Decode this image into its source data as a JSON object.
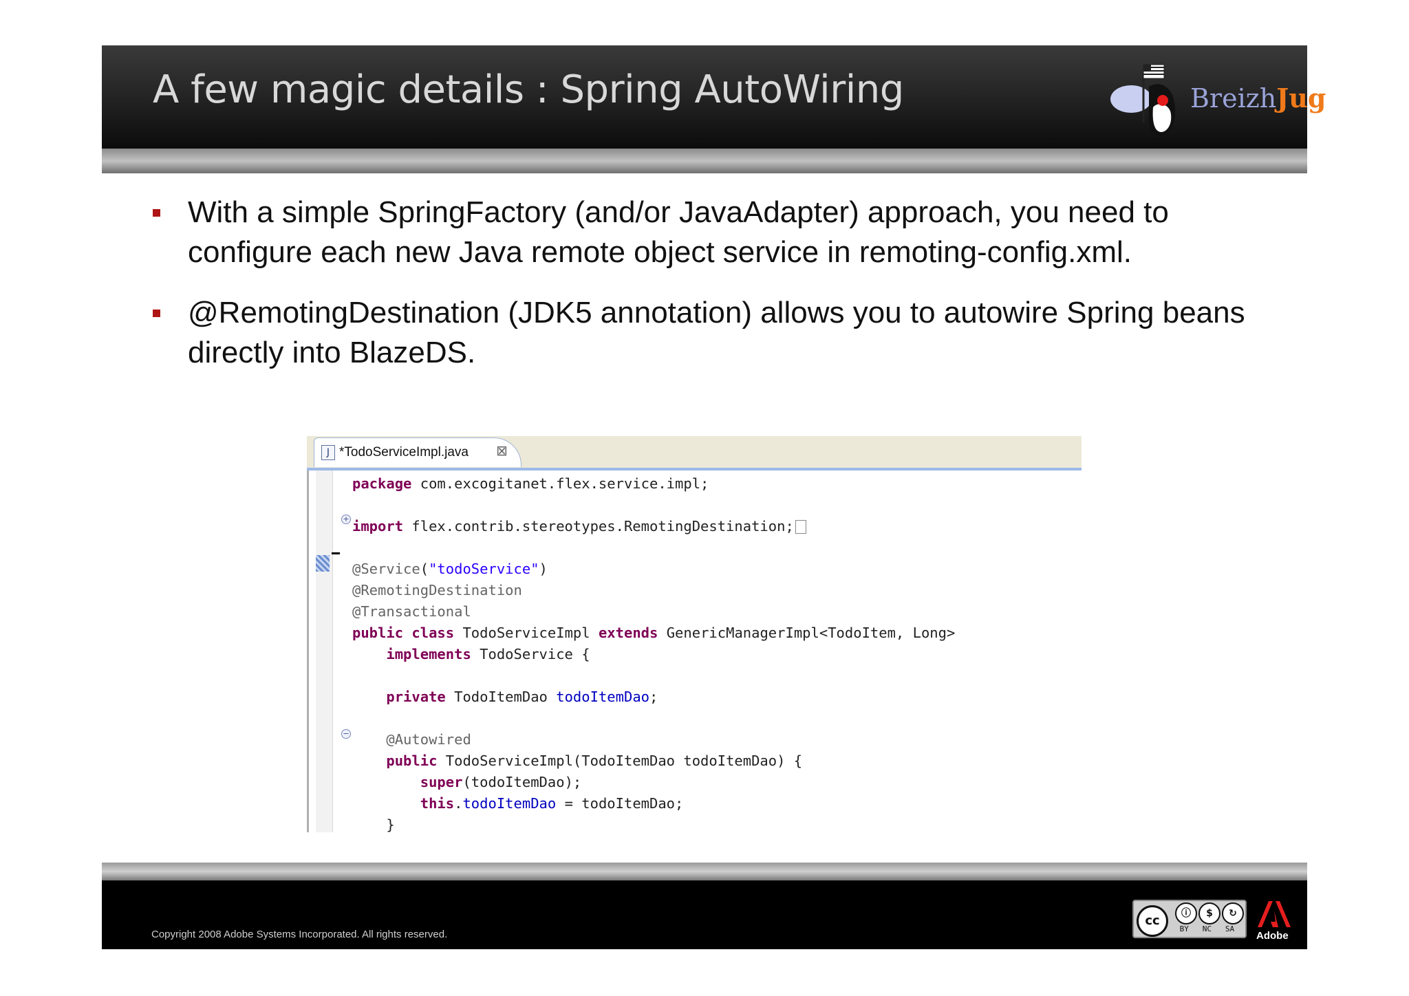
{
  "slide": {
    "title": "A few magic details : Spring AutoWiring",
    "logo": {
      "text_main": "Breizh",
      "text_accent": "Jug"
    },
    "bullets": [
      {
        "text": " With a simple SpringFactory (and/or JavaAdapter) approach, you need to configure each new Java remote object service  in remoting-config.xml."
      },
      {
        "text": "@RemotingDestination (JDK5 annotation) allows you to autowire Spring beans directly into BlazeDS."
      }
    ],
    "footer": {
      "copyright": "Copyright 2008 Adobe Systems Incorporated.  All rights reserved.",
      "license_badge": {
        "cc": "cc",
        "labels": " BY   NC   SA"
      },
      "adobe_label": "Adobe"
    },
    "colors": {
      "bullet": "#b01515",
      "keyword": "#7f0055",
      "string": "#2a00ff",
      "field": "#0000c0",
      "annotation": "#646464"
    }
  },
  "editor": {
    "tab_label": "*TodoServiceImpl.java",
    "tab_icon": "java-file-icon",
    "lines": [
      {
        "kw": "package",
        "rest": " com.excogitanet.flex.service.impl;"
      },
      {
        "kw": "import",
        "rest": " flex.contrib.stereotypes.RemotingDestination;"
      },
      {
        "ann": "@Service",
        "p1": "(",
        "str": "\"todoService\"",
        "p2": ")"
      },
      {
        "ann": "@RemotingDestination"
      },
      {
        "ann": "@Transactional"
      },
      {
        "kw1": "public",
        "kw2": "class",
        "t1": " TodoServiceImpl ",
        "kw3": "extends",
        "t2": " GenericManagerImpl<TodoItem, Long>"
      },
      {
        "indent": "    ",
        "kw": "implements",
        "rest": " TodoService {"
      },
      {
        "indent": "    ",
        "kw": "private",
        "t1": " TodoItemDao ",
        "fld": "todoItemDao",
        "t2": ";"
      },
      {
        "indent": "    ",
        "ann": "@Autowired"
      },
      {
        "indent": "    ",
        "kw": "public",
        "rest": " TodoServiceImpl(TodoItemDao todoItemDao) {"
      },
      {
        "indent": "        ",
        "kw": "super",
        "rest": "(todoItemDao);"
      },
      {
        "indent": "        ",
        "kw": "this",
        "dot": ".",
        "fld": "todoItemDao",
        "rest": " = todoItemDao;"
      },
      {
        "indent": "    ",
        "rest": "}"
      }
    ]
  }
}
